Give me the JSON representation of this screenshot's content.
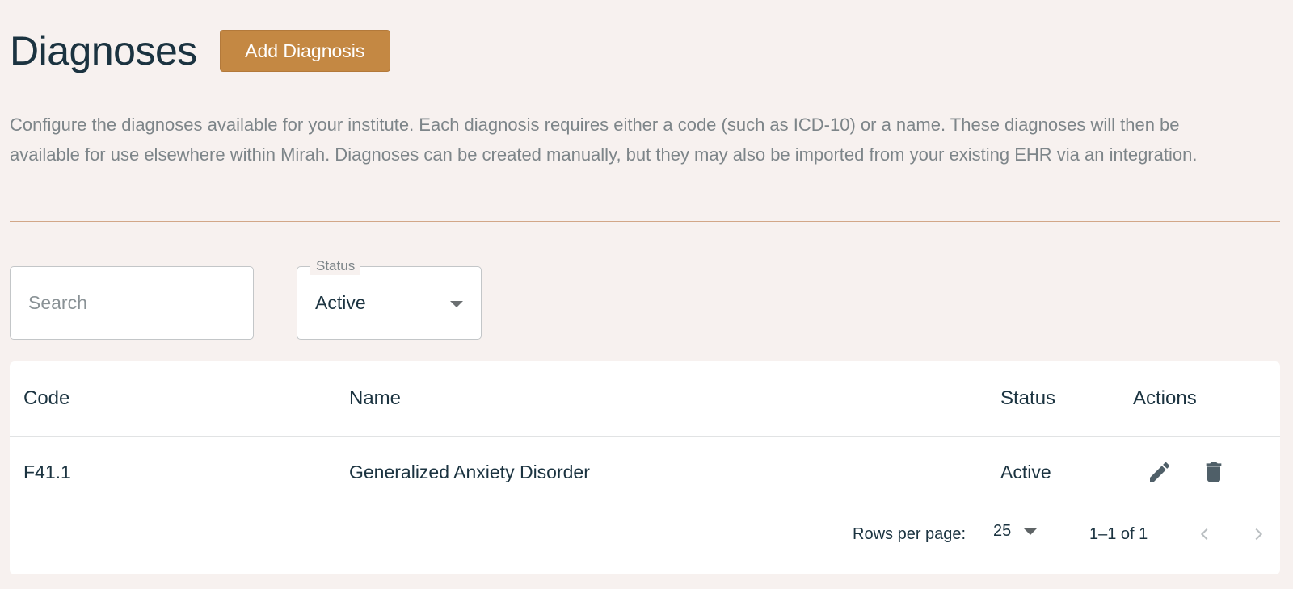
{
  "header": {
    "title": "Diagnoses",
    "add_button_label": "Add Diagnosis"
  },
  "description": "Configure the diagnoses available for your institute. Each diagnosis requires either a code (such as ICD-10) or a name. These diagnoses will then be available for use elsewhere within Mirah. Diagnoses can be created manually, but they may also be imported from your existing EHR via an integration.",
  "filters": {
    "search": {
      "placeholder": "Search",
      "value": ""
    },
    "status": {
      "label": "Status",
      "value": "Active"
    }
  },
  "table": {
    "columns": {
      "code": "Code",
      "name": "Name",
      "status": "Status",
      "actions": "Actions"
    },
    "rows": [
      {
        "code": "F41.1",
        "name": "Generalized Anxiety Disorder",
        "status": "Active",
        "actions": [
          "edit-icon",
          "delete-icon"
        ]
      }
    ]
  },
  "pagination": {
    "rows_per_page_label": "Rows per page:",
    "rows_per_page_value": "25",
    "range_text": "1–1 of 1"
  },
  "colors": {
    "background": "#f7f1ef",
    "primary_button": "#c48843",
    "heading": "#1b3340",
    "divider": "#d2a788",
    "muted_text": "#7d8589"
  }
}
